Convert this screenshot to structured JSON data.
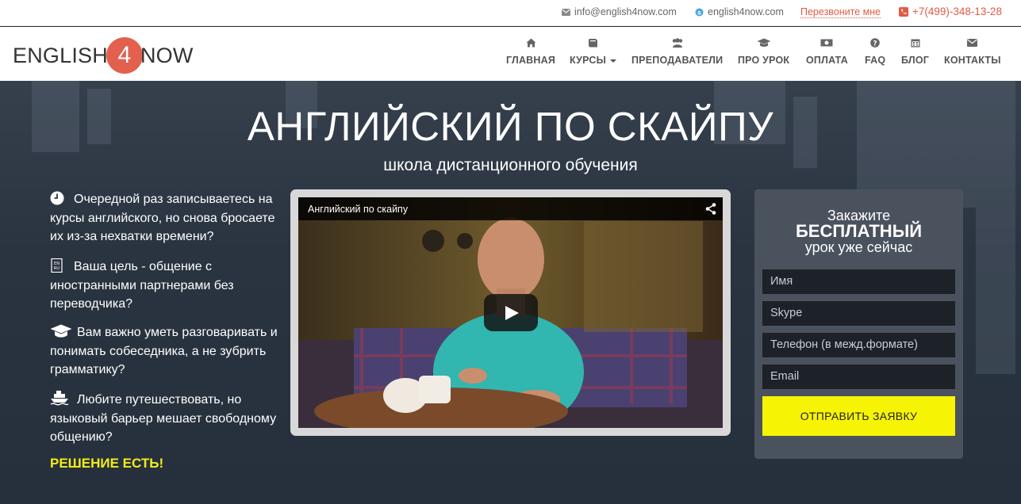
{
  "topbar": {
    "email": "info@english4now.com",
    "skype": "english4now.com",
    "callback": "Перезвоните мне",
    "phone": "+7(499)-348-13-28"
  },
  "logo": {
    "left": "ENGLISH",
    "number": "4",
    "right": "NOW",
    "accent_color": "#e2604d"
  },
  "nav": [
    {
      "label": "ГЛАВНАЯ",
      "icon": "home-icon"
    },
    {
      "label": "КУРСЫ",
      "icon": "book-icon"
    },
    {
      "label": "ПРЕПОДАВАТЕЛИ",
      "icon": "users-icon"
    },
    {
      "label": "ПРО УРОК",
      "icon": "graduation-cap-icon"
    },
    {
      "label": "ОПЛАТА",
      "icon": "money-icon"
    },
    {
      "label": "FAQ",
      "icon": "question-circle-icon"
    },
    {
      "label": "БЛОГ",
      "icon": "calendar-icon"
    },
    {
      "label": "КОНТАКТЫ",
      "icon": "envelope-icon"
    }
  ],
  "hero": {
    "title": "АНГЛИЙСКИЙ ПО СКАЙПУ",
    "subtitle": "школа дистанционного обучения"
  },
  "points": [
    {
      "icon": "clock-icon",
      "text": "Очередной раз записываетесь на курсы английского, но снова бросаете их из-за нехватки времени?"
    },
    {
      "icon": "dictionary-icon",
      "text": "Ваша цель - общение с иностранными партнерами без переводчика?"
    },
    {
      "icon": "graduation-cap-icon",
      "text": "Вам важно уметь разговаривать и понимать собеседника, а не зубрить грамматику?"
    },
    {
      "icon": "ship-icon",
      "text": "Любите путешествовать, но языковый барьер мешает свободному общению?"
    }
  ],
  "solution": "РЕШЕНИЕ ЕСТЬ!",
  "video": {
    "title": "Английский по скайпу"
  },
  "form": {
    "line1": "Закажите",
    "line2": "БЕСПЛАТНЫЙ",
    "line3": "урок уже сейчас",
    "fields": [
      {
        "placeholder": "Имя"
      },
      {
        "placeholder": "Skype"
      },
      {
        "placeholder": "Телефон (в межд.формате)"
      },
      {
        "placeholder": "Email"
      }
    ],
    "submit": "ОТПРАВИТЬ ЗАЯВКУ",
    "submit_color": "#f7f305"
  }
}
